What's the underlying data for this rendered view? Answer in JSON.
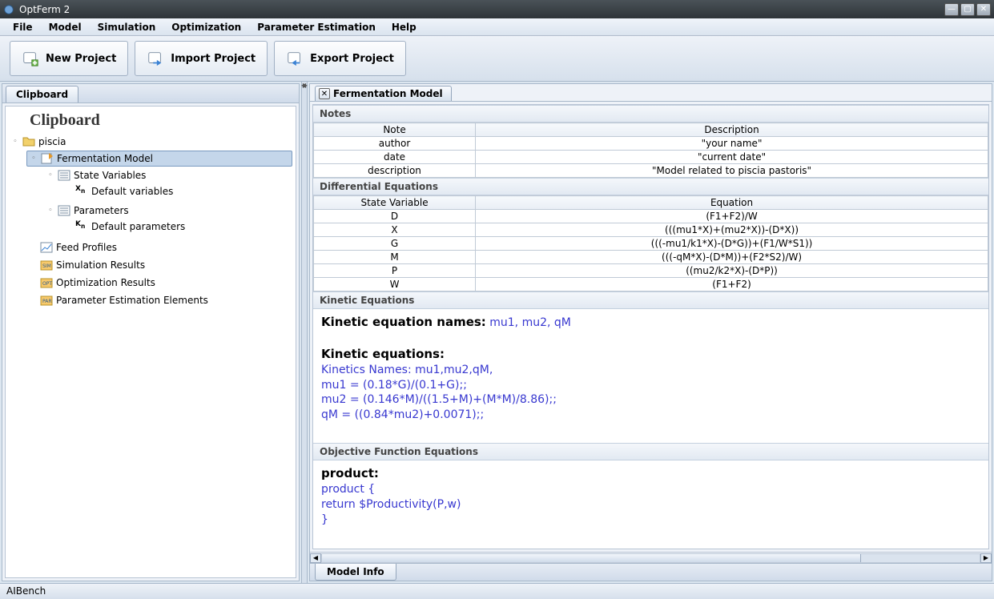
{
  "window": {
    "title": "OptFerm 2"
  },
  "menubar": [
    "File",
    "Model",
    "Simulation",
    "Optimization",
    "Parameter Estimation",
    "Help"
  ],
  "toolbar": {
    "new_project": "New Project",
    "import_project": "Import Project",
    "export_project": "Export Project"
  },
  "left_panel": {
    "tab_label": "Clipboard",
    "heading": "Clipboard"
  },
  "tree": {
    "root": {
      "label": "piscia"
    },
    "fermentation_model": {
      "label": "Fermentation Model"
    },
    "state_variables": {
      "label": "State Variables"
    },
    "default_variables": {
      "label": "Default variables"
    },
    "parameters": {
      "label": "Parameters"
    },
    "default_parameters": {
      "label": "Default parameters"
    },
    "feed_profiles": {
      "label": "Feed Profiles"
    },
    "simulation_results": {
      "label": "Simulation Results"
    },
    "optimization_results": {
      "label": "Optimization Results"
    },
    "param_est_elements": {
      "label": "Parameter Estimation Elements"
    }
  },
  "doc_tab": {
    "label": "Fermentation Model"
  },
  "sections": {
    "notes": "Notes",
    "diff_eq": "Differential Equations",
    "kinetic": "Kinetic Equations",
    "objective": "Objective Function Equations"
  },
  "notes_table": {
    "headers": [
      "Note",
      "Description"
    ],
    "rows": [
      {
        "note": "author",
        "desc": "\"your name\""
      },
      {
        "note": "date",
        "desc": "\"current date\""
      },
      {
        "note": "description",
        "desc": "\"Model related to piscia pastoris\""
      }
    ]
  },
  "diff_eq_table": {
    "headers": [
      "State Variable",
      "Equation"
    ],
    "rows": [
      {
        "var": "D",
        "eq": "(F1+F2)/W"
      },
      {
        "var": "X",
        "eq": "(((mu1*X)+(mu2*X))-(D*X))"
      },
      {
        "var": "G",
        "eq": "(((-mu1/k1*X)-(D*G))+(F1/W*S1))"
      },
      {
        "var": "M",
        "eq": "(((-qM*X)-(D*M))+(F2*S2)/W)"
      },
      {
        "var": "P",
        "eq": "((mu2/k2*X)-(D*P))"
      },
      {
        "var": "W",
        "eq": "(F1+F2)"
      }
    ]
  },
  "kinetic": {
    "names_label": "Kinetic equation names:",
    "names": "mu1, mu2, qM",
    "eq_label": "Kinetic equations:",
    "lines": [
      "Kinetics Names: mu1,mu2,qM,",
      "mu1 = (0.18*G)/(0.1+G);;",
      "mu2 = (0.146*M)/((1.5+M)+(M*M)/8.86);;",
      "qM = ((0.84*mu2)+0.0071);;"
    ]
  },
  "objective": {
    "label": "product:",
    "lines": [
      "product    {",
      "return $Productivity(P,w)",
      "}"
    ]
  },
  "bottom_tab": "Model Info",
  "statusbar": "AIBench"
}
